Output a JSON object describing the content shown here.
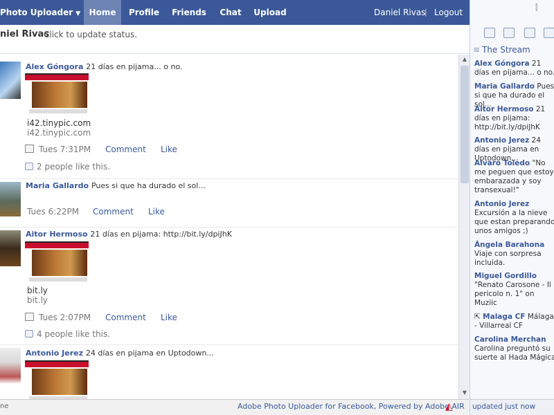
{
  "nav": {
    "app_title": "Photo Uploader",
    "items": [
      "Home",
      "Profile",
      "Friends",
      "Chat",
      "Upload"
    ],
    "user": "Daniel Rivas",
    "logout": "Logout",
    "separator": "|"
  },
  "status": {
    "name": "niel Rivas",
    "prompt": "Click to update status."
  },
  "posts": [
    {
      "author": "Alex Góngora",
      "message": "21 días en pijama... o no.",
      "link_title": "i42.tinypic.com",
      "link_url": "i42.tinypic.com",
      "time": "Tues 7:31PM",
      "comment": "Comment",
      "like": "Like",
      "likes": "2 people like this."
    },
    {
      "author": "Maria Gallardo",
      "message": "Pues si que ha durado el sol...",
      "time": "Tues 6:22PM",
      "comment": "Comment",
      "like": "Like"
    },
    {
      "author": "Aitor Hermoso",
      "message": "21 días en pijama: http://bit.ly/dpiJhK",
      "link_title": "bit.ly",
      "link_url": "bit.ly",
      "time": "Tues 2:07PM",
      "comment": "Comment",
      "like": "Like",
      "likes": "4 people like this."
    },
    {
      "author": "Antonio Jerez",
      "message": "24 días en pijama en Uptodown..."
    }
  ],
  "footer": {
    "left": "ne",
    "credit": "Adobe Photo Uploader for Facebook, Powered by Adobe AIR"
  },
  "sidebar": {
    "title": "The Stream",
    "updated": "updated just now",
    "items": [
      {
        "name": "Alex Góngora",
        "text": "21 días en pijama... o no."
      },
      {
        "name": "Maria Gallardo",
        "text": "Pues si que ha durado el sol..."
      },
      {
        "name": "Aitor Hermoso",
        "text": "21 días en pijama: http://bit.ly/dpiJhK"
      },
      {
        "name": "Antonio Jerez",
        "text": "24 días en pijama en Uptodown..."
      },
      {
        "name": "Alvaro Toledo",
        "text": "\"No me peguen que estoy embarazada y soy transexual!\""
      },
      {
        "name": "Antonio Jerez",
        "text": "Excursión a la nieve que estan preparando unos amigos ;)"
      },
      {
        "name": "Ángela Barahona",
        "text": "Viaje con sorpresa incluida."
      },
      {
        "name": "Miguel Gordillo",
        "text": "\"Renato Carosone - Il pericolo n. 1\" on Muziic"
      },
      {
        "name": "Malaga CF",
        "text": "Málaga - Villarreal CF"
      },
      {
        "name": "Carolina Merchan",
        "text": "Carolina preguntó su suerte al Hada Mágica"
      }
    ]
  }
}
